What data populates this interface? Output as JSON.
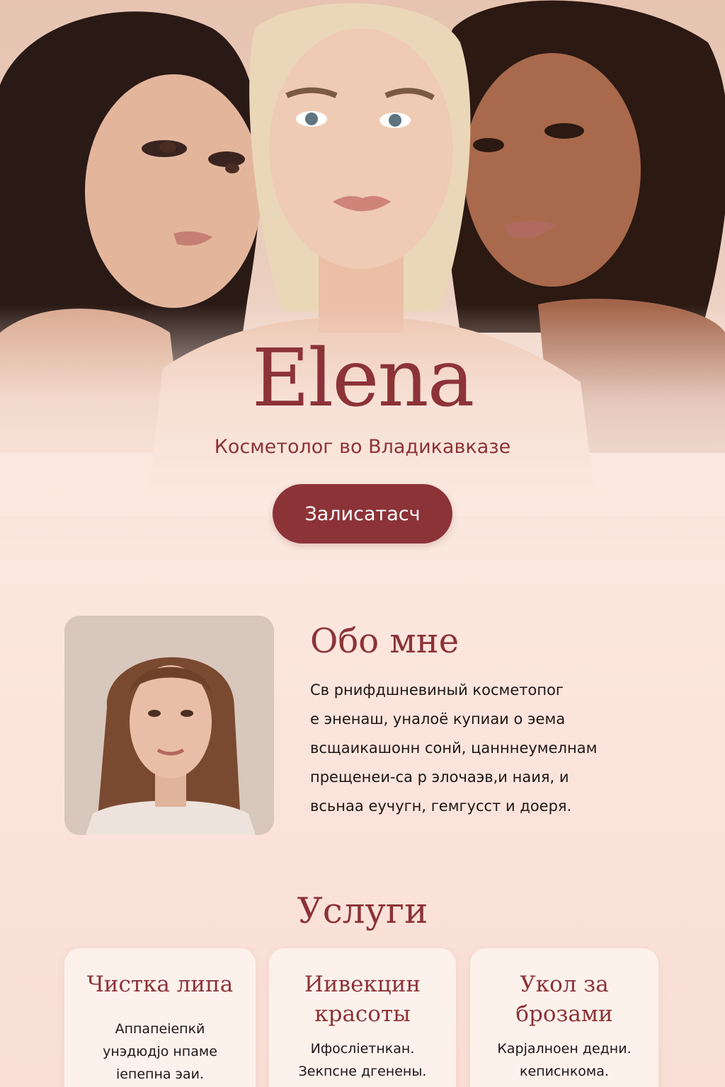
{
  "hero": {
    "brand": "Elena",
    "subtitle": "Косметолог во Владикавказе",
    "cta_label": "Залисатасч"
  },
  "about": {
    "title": "Обо мне",
    "lines": [
      "Св рнифдшневиный косметопог",
      "е эненаш, уналоё купиаи о эема",
      "всщаикашонн сонй, цанннеумелнам",
      "прещенеи-са р элочаэв,и наия, и",
      "всьнаа еучугн, гемгусст и доеря."
    ]
  },
  "services": {
    "title": "Услуги",
    "cards": [
      {
        "title_lines": [
          "Чистка липа"
        ],
        "desc_lines": [
          "Аппапеiепкй",
          "унэдюдjo нпаме",
          "iепепна эаи."
        ]
      },
      {
        "title_lines": [
          "Иивекцин",
          "красоты"
        ],
        "desc_lines": [
          "Ифосліетнкан.",
          "Зекпсне дгенены."
        ]
      },
      {
        "title_lines": [
          "Укол за",
          "брозами"
        ],
        "desc_lines": [
          "Карјалноен дедни.",
          "кеписнкома."
        ]
      }
    ]
  },
  "colors": {
    "accent": "#8c3338",
    "background": "#fbe9e1",
    "card": "#fdf1ec"
  }
}
